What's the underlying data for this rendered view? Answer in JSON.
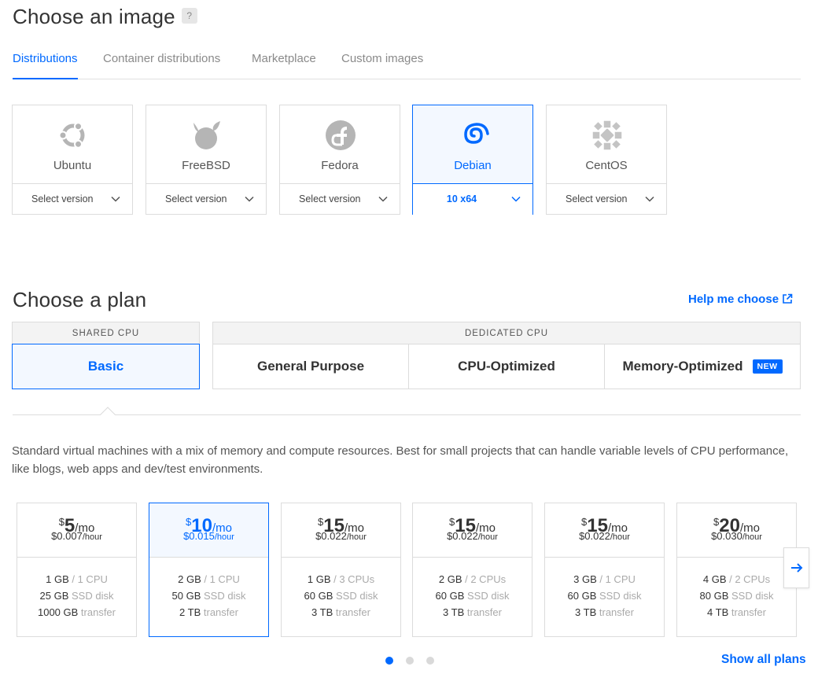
{
  "image_section": {
    "title": "Choose an image",
    "help": "?",
    "tabs": [
      {
        "label": "Distributions",
        "active": true
      },
      {
        "label": "Container distributions",
        "active": false
      },
      {
        "label": "Marketplace",
        "active": false
      },
      {
        "label": "Custom images",
        "active": false
      }
    ],
    "distros": [
      {
        "name": "Ubuntu",
        "icon": "ubuntu-icon",
        "version": "Select version"
      },
      {
        "name": "FreeBSD",
        "icon": "freebsd-icon",
        "version": "Select version"
      },
      {
        "name": "Fedora",
        "icon": "fedora-icon",
        "version": "Select version"
      },
      {
        "name": "Debian",
        "icon": "debian-icon",
        "version": "10 x64",
        "selected": true
      },
      {
        "name": "CentOS",
        "icon": "centos-icon",
        "version": "Select version"
      }
    ]
  },
  "plan_section": {
    "title": "Choose a plan",
    "help_link": "Help me choose",
    "shared_header": "SHARED CPU",
    "dedicated_header": "DEDICATED CPU",
    "options": {
      "basic": "Basic",
      "general": "General Purpose",
      "cpu_opt": "CPU-Optimized",
      "mem_opt": "Memory-Optimized"
    },
    "new_badge": "NEW",
    "description": "Standard virtual machines with a mix of memory and compute resources. Best for small projects that can handle variable levels of CPU performance, like blogs, web apps and dev/test environments.",
    "plans": [
      {
        "currency": "$",
        "amount": "5",
        "per": "/mo",
        "hourly": "$0.007",
        "hour_unit": "/hour",
        "mem": "1 GB",
        "cpu": " / 1 CPU",
        "disk": "25 GB",
        "disk_unit": " SSD disk",
        "transfer": "1000 GB",
        "transfer_unit": " transfer"
      },
      {
        "currency": "$",
        "amount": "10",
        "per": "/mo",
        "hourly": "$0.015",
        "hour_unit": "/hour",
        "mem": "2 GB",
        "cpu": " / 1 CPU",
        "disk": "50 GB",
        "disk_unit": " SSD disk",
        "transfer": "2 TB",
        "transfer_unit": " transfer",
        "selected": true
      },
      {
        "currency": "$",
        "amount": "15",
        "per": "/mo",
        "hourly": "$0.022",
        "hour_unit": "/hour",
        "mem": "1 GB",
        "cpu": " / 3 CPUs",
        "disk": "60 GB",
        "disk_unit": " SSD disk",
        "transfer": "3 TB",
        "transfer_unit": " transfer"
      },
      {
        "currency": "$",
        "amount": "15",
        "per": "/mo",
        "hourly": "$0.022",
        "hour_unit": "/hour",
        "mem": "2 GB",
        "cpu": " / 2 CPUs",
        "disk": "60 GB",
        "disk_unit": " SSD disk",
        "transfer": "3 TB",
        "transfer_unit": " transfer"
      },
      {
        "currency": "$",
        "amount": "15",
        "per": "/mo",
        "hourly": "$0.022",
        "hour_unit": "/hour",
        "mem": "3 GB",
        "cpu": " / 1 CPU",
        "disk": "60 GB",
        "disk_unit": " SSD disk",
        "transfer": "3 TB",
        "transfer_unit": " transfer"
      },
      {
        "currency": "$",
        "amount": "20",
        "per": "/mo",
        "hourly": "$0.030",
        "hour_unit": "/hour",
        "mem": "4 GB",
        "cpu": " / 2 CPUs",
        "disk": "80 GB",
        "disk_unit": " SSD disk",
        "transfer": "4 TB",
        "transfer_unit": " transfer"
      }
    ],
    "pagination": {
      "pages": 3,
      "current": 1
    },
    "show_all": "Show all plans"
  },
  "colors": {
    "accent": "#0069ff",
    "border": "#dcdcdc",
    "muted_text": "#8a8a8a",
    "selected_bg": "#f3f8ff"
  }
}
